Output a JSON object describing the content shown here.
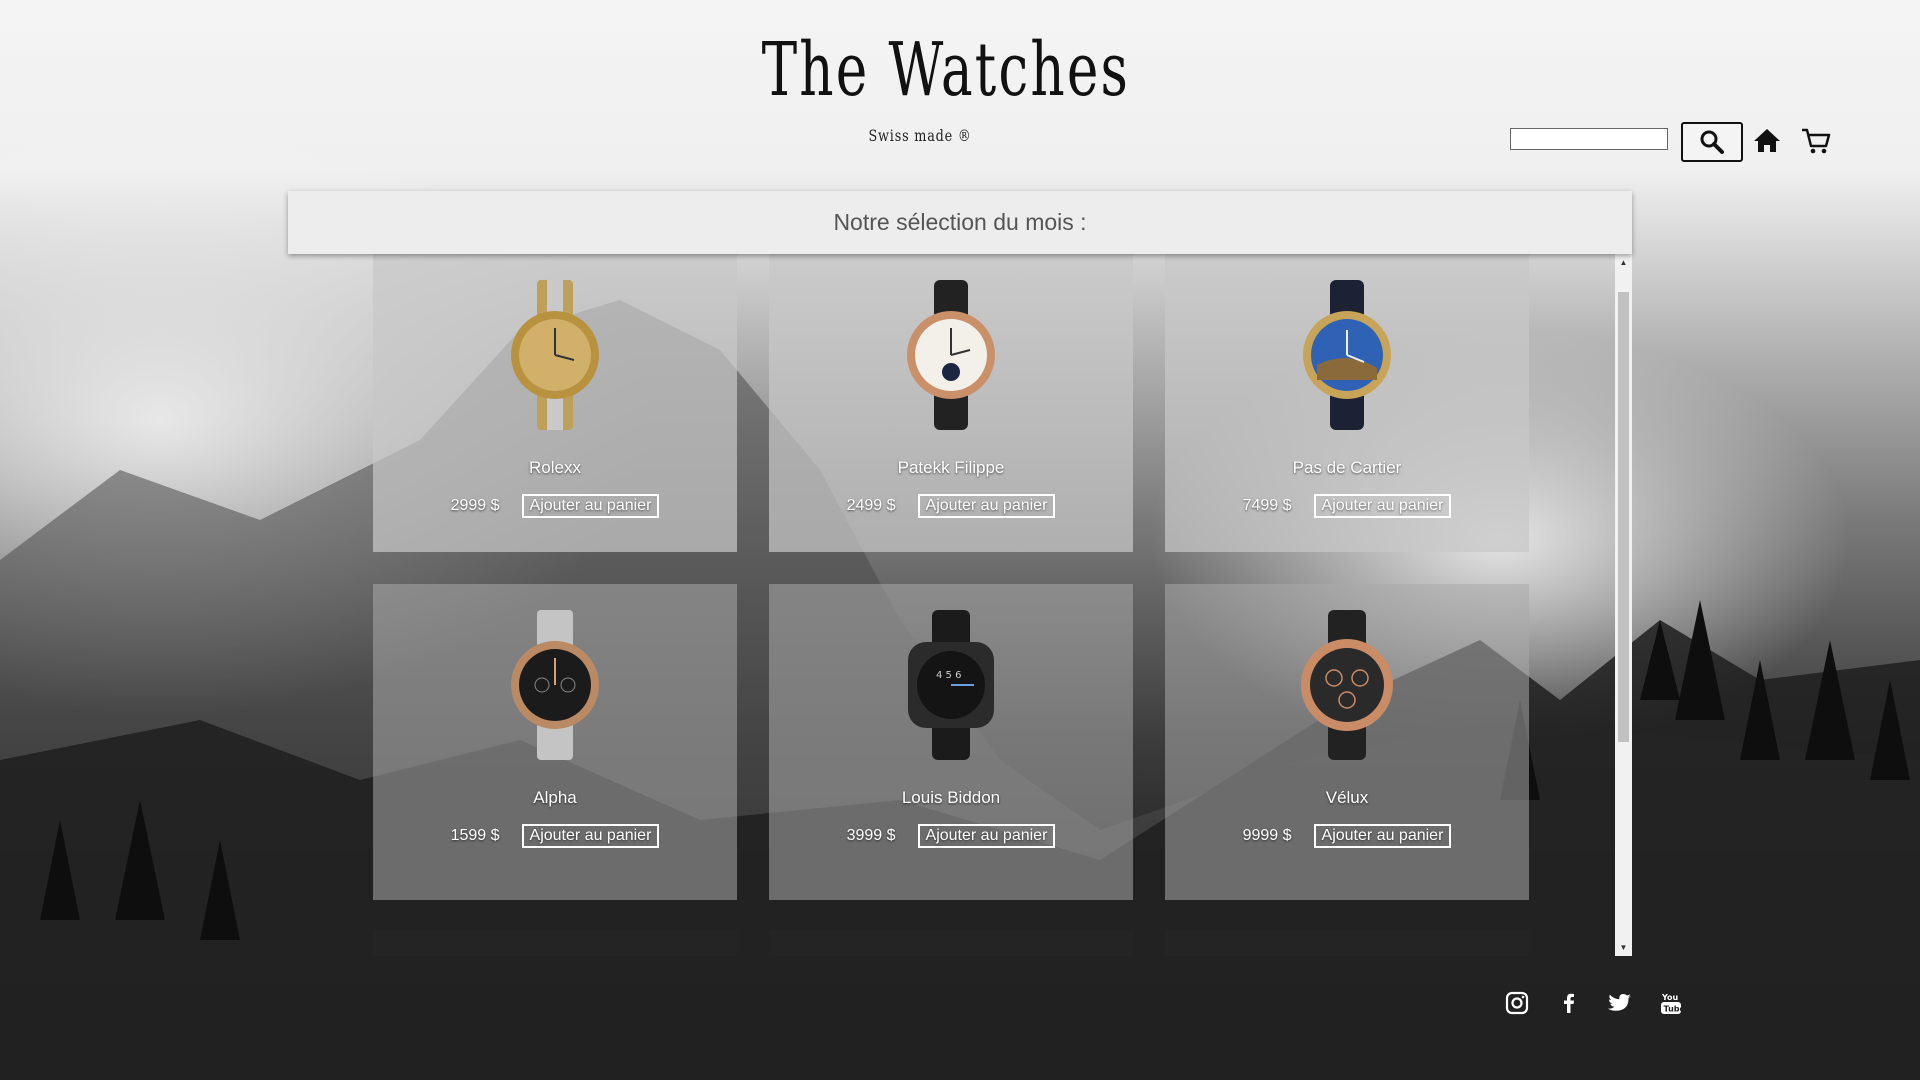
{
  "brand": {
    "title": "The Watches",
    "subtitle": "Swiss made ®"
  },
  "header": {
    "search_placeholder": "",
    "icons": [
      "search-icon",
      "home-icon",
      "cart-icon"
    ]
  },
  "selection": {
    "heading": "Notre sélection du mois :"
  },
  "products": [
    {
      "name": "Rolexx",
      "price": "2999 $",
      "add_label": "Ajouter au panier",
      "image": "gold-two-tone-watch"
    },
    {
      "name": "Patekk Filippe",
      "price": "2499 $",
      "add_label": "Ajouter au panier",
      "image": "rose-gold-moonphase-watch"
    },
    {
      "name": "Pas de Cartier",
      "price": "7499 $",
      "add_label": "Ajouter au panier",
      "image": "blue-dial-diamond-watch"
    },
    {
      "name": "Alpha",
      "price": "1599 $",
      "add_label": "Ajouter au panier",
      "image": "black-chronograph-steel-watch"
    },
    {
      "name": "Louis Biddon",
      "price": "3999 $",
      "add_label": "Ajouter au panier",
      "image": "black-square-sport-watch"
    },
    {
      "name": "Vélux",
      "price": "9999 $",
      "add_label": "Ajouter au panier",
      "image": "rose-gold-skeleton-watch"
    }
  ],
  "footer": {
    "social_icons": [
      "instagram-icon",
      "facebook-icon",
      "twitter-icon",
      "youtube-icon"
    ]
  },
  "colors": {
    "card_bg": "#c8c8c8",
    "text_light": "#ffffff",
    "bar_bg": "#ededed"
  }
}
